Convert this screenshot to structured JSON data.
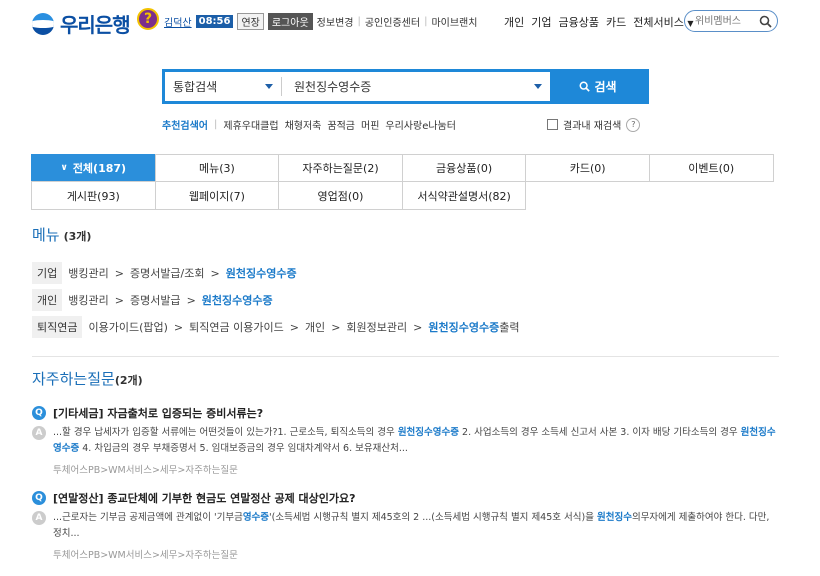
{
  "header": {
    "logo_text": "우리은행",
    "help_badge": "?",
    "user_name": "김덕산",
    "timer": "08:56",
    "extend_label": "연장",
    "logout_label": "로그아웃",
    "links": [
      "정보변경",
      "공인인증센터",
      "마이브랜치"
    ],
    "gnb": [
      "개인",
      "기업",
      "금융상품",
      "카드",
      "전체서비스"
    ],
    "top_search_placeholder": "위비멤버스"
  },
  "search": {
    "category": "통합검색",
    "query": "원천징수영수증",
    "button_label": "검색",
    "recommend_label": "추천검색어",
    "recommend_items": [
      "제휴우대클럽",
      "채형저축",
      "꿈적금",
      "머핀",
      "우리사랑e나눔터"
    ],
    "within_label": "결과내 재검색"
  },
  "tabs": {
    "row1": [
      "전체(187)",
      "메뉴(3)",
      "자주하는질문(2)",
      "금융상품(0)",
      "카드(0)",
      "이벤트(0)"
    ],
    "row2": [
      "게시판(93)",
      "웹페이지(7)",
      "영업점(0)",
      "서식약관설명서(82)"
    ]
  },
  "menu_section": {
    "title": "메뉴",
    "count": "(3개)",
    "paths": [
      {
        "tag": "기업",
        "segments": [
          "뱅킹관리",
          "증명서발급/조회"
        ],
        "highlight": "원천징수영수증",
        "suffix": ""
      },
      {
        "tag": "개인",
        "segments": [
          "뱅킹관리",
          "증명서발급"
        ],
        "highlight": "원천징수영수증",
        "suffix": ""
      },
      {
        "tag": "퇴직연금",
        "segments": [
          "이용가이드(팝업)",
          "퇴직연금 이용가이드",
          "개인",
          "회원정보관리"
        ],
        "highlight": "원천징수영수증",
        "suffix": "출력"
      }
    ]
  },
  "faq_section": {
    "title": "자주하는질문",
    "count": "(2개)",
    "items": [
      {
        "question": "[기타세금] 자금출처로 입증되는 증비서류는?",
        "answer_parts": [
          {
            "t": "...할 경우 납세자가 입증할 서류에는 어떤것들이 있는가?1. 근로소득, 퇴직소득의 경우 ",
            "h": false
          },
          {
            "t": "원천징수영수증",
            "h": true
          },
          {
            "t": " 2. 사업소득의 경우 소득세 신고서 사본 3. 이자 배당 기타소득의 경우 ",
            "h": false
          },
          {
            "t": "원천징수영수증",
            "h": true
          },
          {
            "t": " 4. 차입금의 경우 부채증명서 5. 임대보증금의 경우 임대차계약서 6. 보유재산처...",
            "h": false
          }
        ],
        "path": "투체어스PB>WM서비스>세무>자주하는질문"
      },
      {
        "question": "[연말정산] 종교단체에 기부한 현금도 연말정산 공제 대상인가요?",
        "answer_parts": [
          {
            "t": "...근로자는 기부금 공제금액에 관계없이 '기부금",
            "h": false
          },
          {
            "t": "영수증",
            "h": true
          },
          {
            "t": "'(소득세법 시행규칙 별지 제45호의 2 ...(소득세법 시행규칙 별지 제45호 서식)을 ",
            "h": false
          },
          {
            "t": "원천징수",
            "h": true
          },
          {
            "t": "의무자에게 제출하여야 한다. 다만, 정치...",
            "h": false
          }
        ],
        "path": "투체어스PB>WM서비스>세무>자주하는질문"
      }
    ]
  },
  "colors": {
    "brand": "#0b4fa3",
    "accent": "#2b8fdb",
    "highlight": "#1b7ac9"
  }
}
